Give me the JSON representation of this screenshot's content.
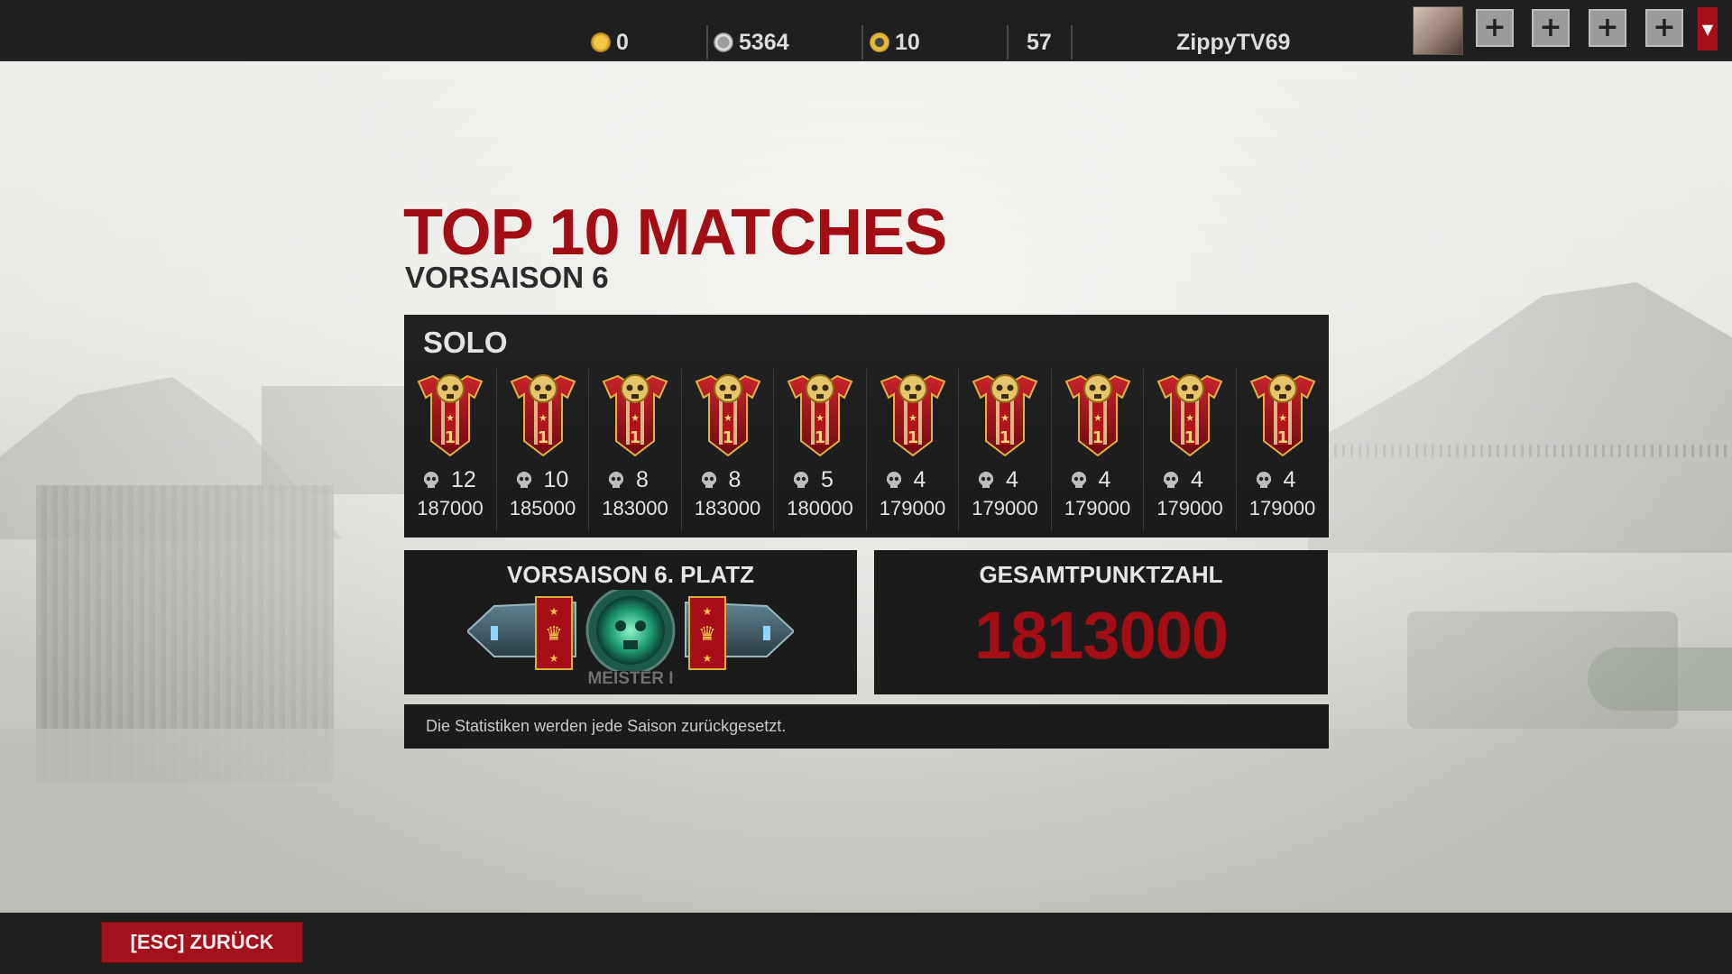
{
  "topbar": {
    "currencies": [
      {
        "icon": "crown-coin-icon",
        "value": "0",
        "color": "#e0a51c"
      },
      {
        "icon": "silver-skull-coin-icon",
        "value": "5364",
        "color": "#b9b9b9"
      },
      {
        "icon": "gear-token-icon",
        "value": "10",
        "color": "#d9b12a"
      }
    ],
    "level": "57",
    "username": "ZippyTV69",
    "plus_buttons": [
      "+",
      "+",
      "+",
      "+"
    ],
    "dropdown": "▼"
  },
  "header": {
    "title": "TOP 10 MATCHES",
    "subtitle": "VORSAISON 6"
  },
  "solo": {
    "label": "SOLO",
    "matches": [
      {
        "kills": "12",
        "score": "187000"
      },
      {
        "kills": "10",
        "score": "185000"
      },
      {
        "kills": "8",
        "score": "183000"
      },
      {
        "kills": "8",
        "score": "183000"
      },
      {
        "kills": "5",
        "score": "180000"
      },
      {
        "kills": "4",
        "score": "179000"
      },
      {
        "kills": "4",
        "score": "179000"
      },
      {
        "kills": "4",
        "score": "179000"
      },
      {
        "kills": "4",
        "score": "179000"
      },
      {
        "kills": "4",
        "score": "179000"
      }
    ]
  },
  "rank": {
    "title": "VORSAISON 6. PLATZ",
    "name": "MEISTER I"
  },
  "total": {
    "title": "GESAMTPUNKTZAHL",
    "value": "1813000"
  },
  "note": "Die Statistiken werden jede Saison zurückgesetzt.",
  "footer": {
    "back_label": "[ESC] ZURÜCK"
  },
  "colors": {
    "accent_red": "#a30d14",
    "panel_dark": "#1b1b1b",
    "bar_dark": "#1f1f1f"
  }
}
